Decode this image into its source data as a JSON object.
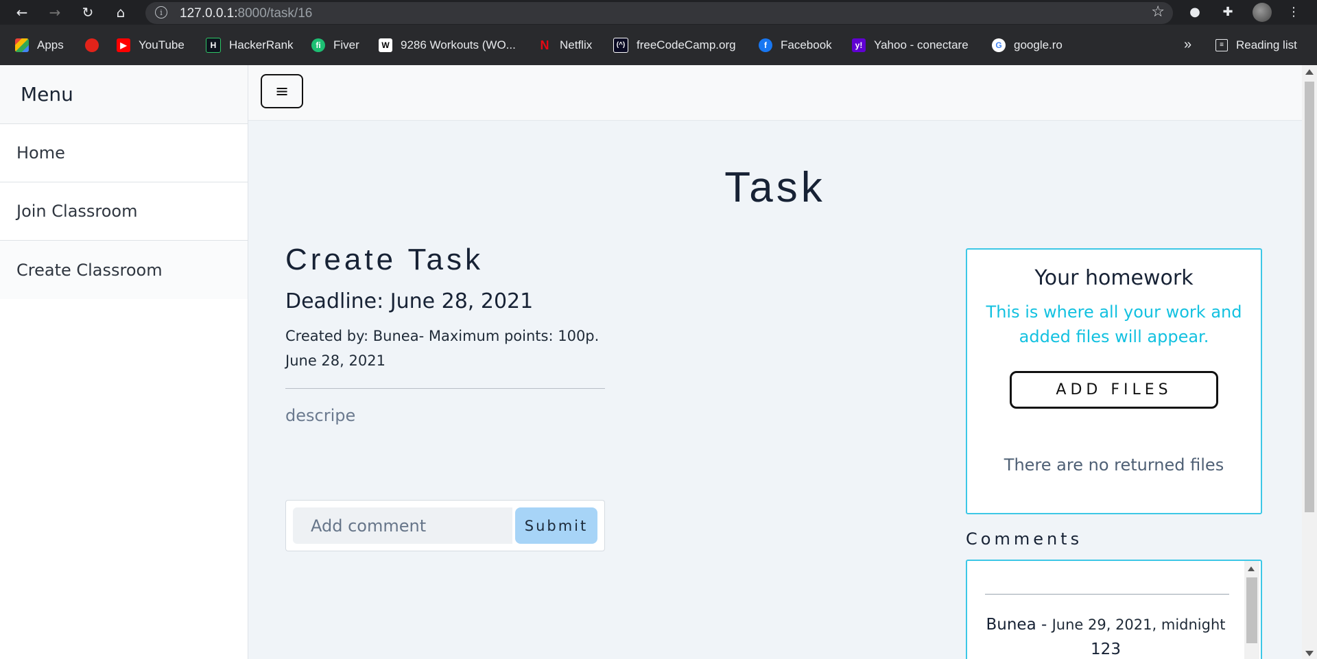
{
  "browser": {
    "url_host": "127.0.0.1:",
    "url_rest": "8000/task/16",
    "bookmarks": [
      {
        "label": "Apps",
        "icon": "apps-grid-icon"
      },
      {
        "label": "",
        "icon": "opera-icon"
      },
      {
        "label": "YouTube",
        "icon": "youtube-icon"
      },
      {
        "label": "HackerRank",
        "icon": "hackerrank-icon"
      },
      {
        "label": "Fiver",
        "icon": "fiverr-icon"
      },
      {
        "label": "9286 Workouts (WO...",
        "icon": "workouts-icon"
      },
      {
        "label": "Netflix",
        "icon": "netflix-icon"
      },
      {
        "label": "freeCodeCamp.org",
        "icon": "freecodecamp-icon"
      },
      {
        "label": "Facebook",
        "icon": "facebook-icon"
      },
      {
        "label": "Yahoo - conectare",
        "icon": "yahoo-icon"
      },
      {
        "label": "google.ro",
        "icon": "google-icon"
      }
    ],
    "overflow": "»",
    "reading_list": "Reading list"
  },
  "sidebar": {
    "title": "Menu",
    "items": [
      {
        "label": "Home"
      },
      {
        "label": "Join Classroom"
      },
      {
        "label": "Create Classroom"
      }
    ]
  },
  "topbar": {
    "toggle_glyph": "≡"
  },
  "page": {
    "title": "Task",
    "task_title": "Create Task",
    "deadline": "Deadline: June 28, 2021",
    "meta_line1": "Created by: Bunea- Maximum points: 100p.",
    "meta_line2": "June 28, 2021",
    "description": "descripe"
  },
  "comment_form": {
    "placeholder": "Add comment",
    "submit_label": "Submit"
  },
  "homework": {
    "title": "Your homework",
    "subtitle": "This is where all your work and added files will appear.",
    "add_files_label": "ADD FILES",
    "empty_text": "There are no returned files"
  },
  "comments": {
    "label": "Comments",
    "items": [
      {
        "author": "Bunea - ",
        "date": "June 29, 2021, midnight",
        "text": "123"
      }
    ]
  },
  "colors": {
    "accent": "#3cc7e6",
    "subtitle_cyan": "#13c1e0",
    "submit_bg": "#a7d4f7",
    "text_dark": "#172235"
  }
}
